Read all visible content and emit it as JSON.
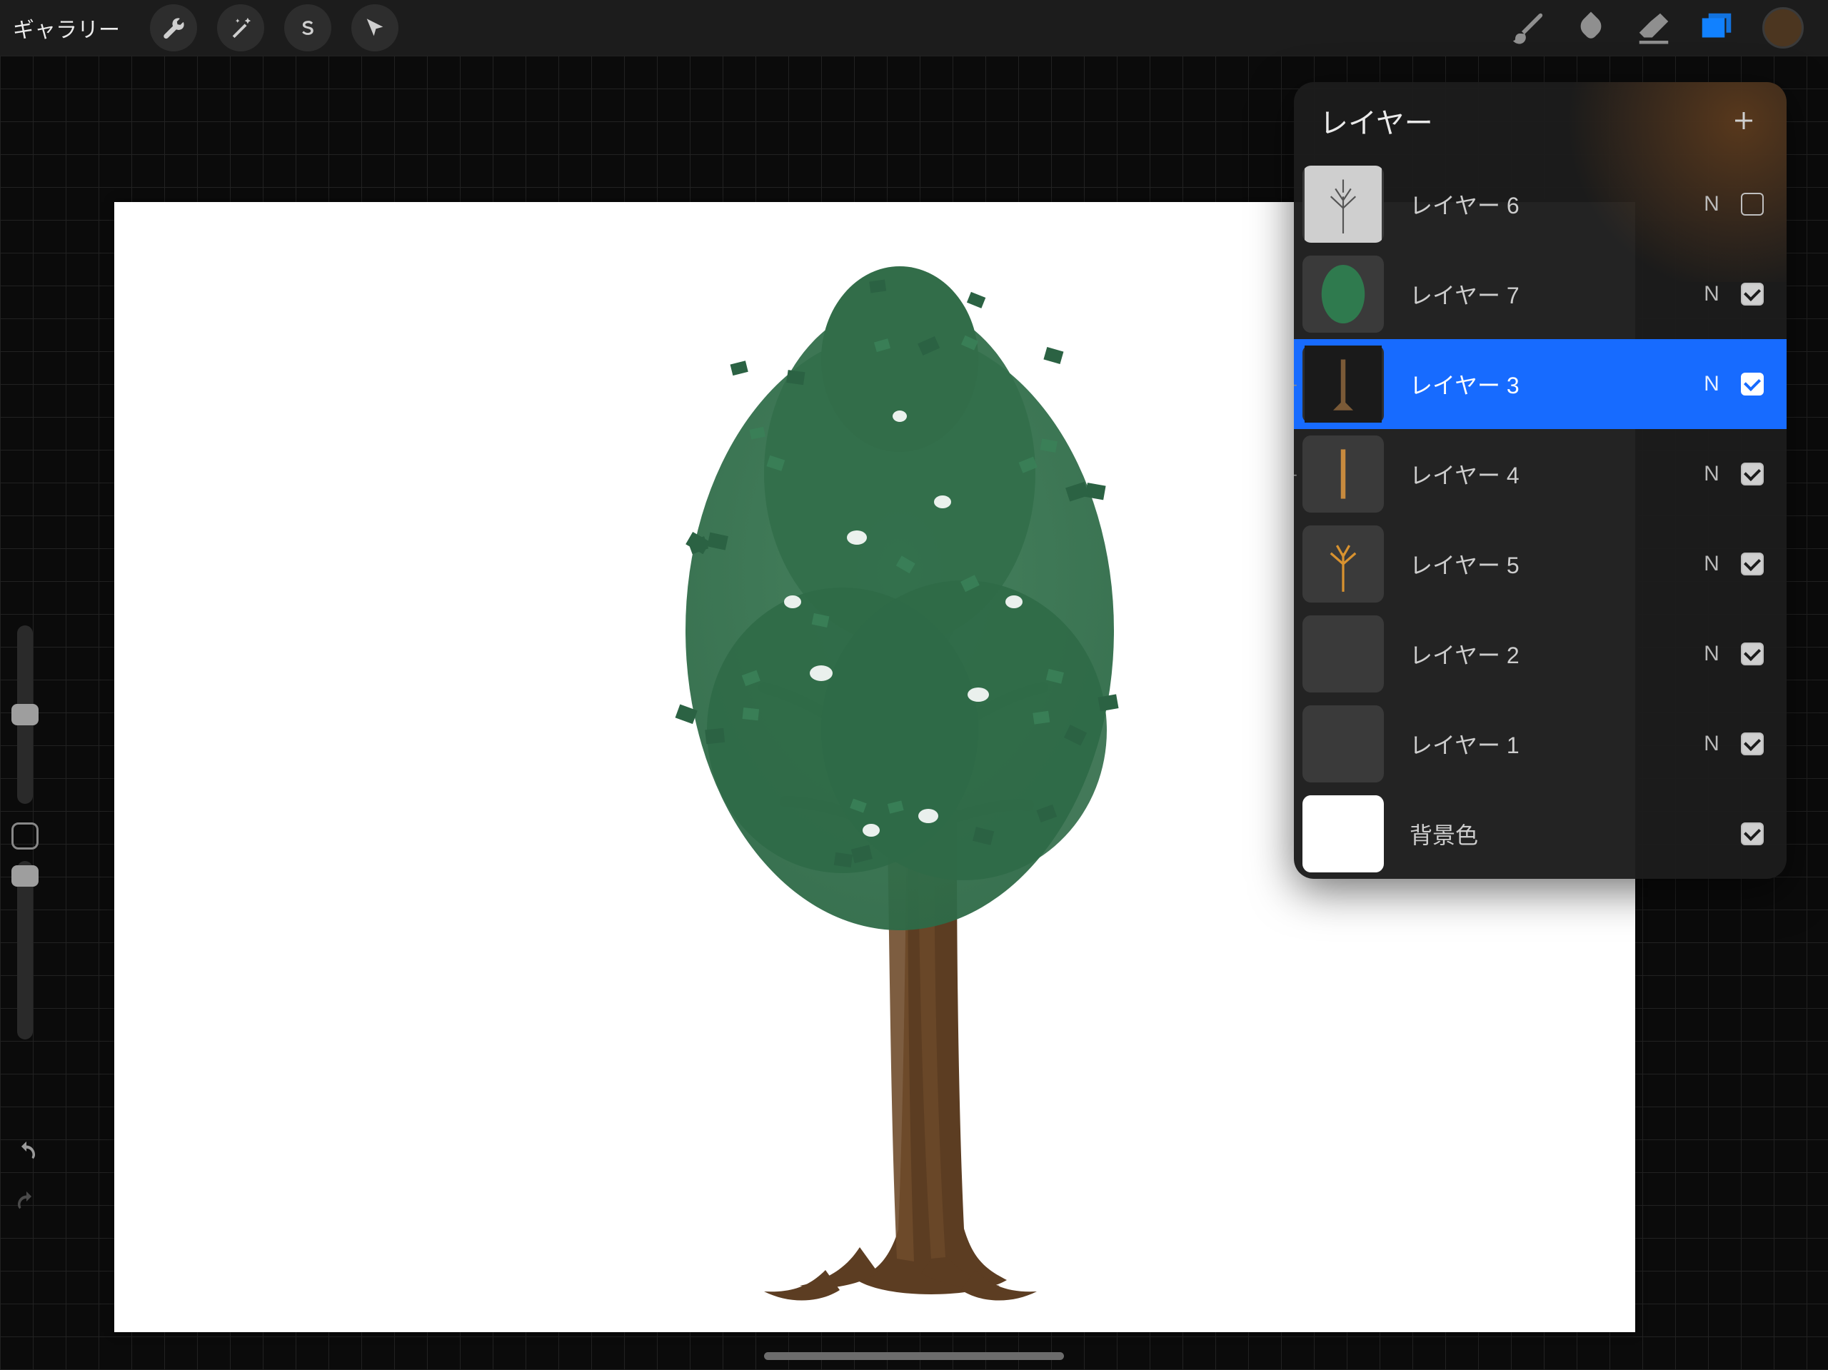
{
  "toolbar": {
    "gallery_label": "ギャラリー",
    "color_swatch": "#4c3620"
  },
  "panel": {
    "title": "レイヤー"
  },
  "layers": [
    {
      "name": "レイヤー 6",
      "blend": "N",
      "visible": false,
      "selected": false,
      "thumb": "sketch"
    },
    {
      "name": "レイヤー 7",
      "blend": "N",
      "visible": true,
      "selected": false,
      "thumb": "foliage"
    },
    {
      "name": "レイヤー 3",
      "blend": "N",
      "visible": true,
      "selected": true,
      "thumb": "darktrunk",
      "clipped": true
    },
    {
      "name": "レイヤー 4",
      "blend": "N",
      "visible": true,
      "selected": false,
      "thumb": "bark",
      "clipped": true
    },
    {
      "name": "レイヤー 5",
      "blend": "N",
      "visible": true,
      "selected": false,
      "thumb": "basetree"
    },
    {
      "name": "レイヤー 2",
      "blend": "N",
      "visible": true,
      "selected": false,
      "thumb": "empty"
    },
    {
      "name": "レイヤー 1",
      "blend": "N",
      "visible": true,
      "selected": false,
      "thumb": "empty"
    },
    {
      "name": "背景色",
      "blend": "",
      "visible": true,
      "selected": false,
      "thumb": "white",
      "is_bg": true
    }
  ]
}
